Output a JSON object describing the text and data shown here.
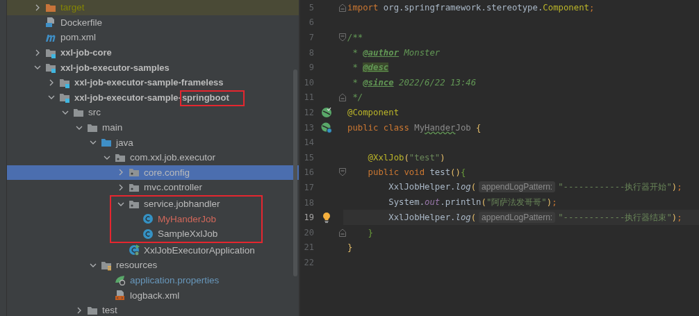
{
  "project_tree": {
    "items": [
      {
        "children": [
          {
            "label": "target",
            "kind": "excluded",
            "color": "#848504",
            "selected": false,
            "annotated": false,
            "expanded": false
          },
          {
            "label": "Dockerfile",
            "kind": "docker",
            "color": "#bbbbbb",
            "selected": false,
            "annotated": false
          },
          {
            "label": "pom.xml",
            "kind": "maven",
            "color": "#bbbbbb",
            "selected": false,
            "annotated": false
          }
        ]
      },
      {
        "label": "xxl-job-core",
        "kind": "module",
        "color": "#bbbbbb",
        "selected": false,
        "annotated": false,
        "expanded": false
      },
      {
        "label": "xxl-job-executor-samples",
        "kind": "module",
        "color": "#bbbbbb",
        "selected": false,
        "annotated": false,
        "expanded": true,
        "children": [
          {
            "label": "xxl-job-executor-sample-frameless",
            "kind": "module",
            "color": "#bbbbbb",
            "selected": false,
            "annotated": false,
            "expanded": false
          },
          {
            "label": "xxl-job-executor-sample-",
            "annotated_label": "springboot",
            "kind": "module",
            "color": "#bbbbbb",
            "selected": false,
            "annotated": false,
            "expanded": true,
            "children": [
              {
                "label": "src",
                "kind": "folder",
                "color": "#bbbbbb",
                "selected": false,
                "annotated": false,
                "expanded": true,
                "children": [
                  {
                    "label": "main",
                    "kind": "folder",
                    "color": "#bbbbbb",
                    "selected": false,
                    "annotated": false,
                    "expanded": true,
                    "children": [
                      {
                        "label": "java",
                        "kind": "source",
                        "color": "#bbbbbb",
                        "selected": false,
                        "annotated": false,
                        "expanded": true,
                        "children": [
                          {
                            "label": "com.xxl.job.executor",
                            "kind": "package",
                            "color": "#bbbbbb",
                            "selected": false,
                            "annotated": false,
                            "expanded": true,
                            "children": [
                              {
                                "label": "core.config",
                                "kind": "package",
                                "color": "#bbbbbb",
                                "selected": true,
                                "annotated": false,
                                "expanded": false
                              },
                              {
                                "label": "mvc.controller",
                                "kind": "package",
                                "color": "#bbbbbb",
                                "selected": false,
                                "annotated": false,
                                "expanded": false
                              },
                              {
                                "label": "service.jobhandler",
                                "kind": "package",
                                "color": "#bbbbbb",
                                "selected": false,
                                "annotated": true,
                                "expanded": true,
                                "children": [
                                  {
                                    "label": "MyHanderJob",
                                    "kind": "class",
                                    "color": "#d1675a",
                                    "selected": false,
                                    "annotated": false
                                  },
                                  {
                                    "label": "SampleXxlJob",
                                    "kind": "class",
                                    "color": "#bbbbbb",
                                    "selected": false,
                                    "annotated": false
                                  }
                                ]
                              },
                              {
                                "label": "XxlJobExecutorApplication",
                                "kind": "springclass",
                                "color": "#bbbbbb",
                                "selected": false,
                                "annotated": false
                              }
                            ]
                          }
                        ]
                      },
                      {
                        "label": "resources",
                        "kind": "resources",
                        "color": "#bbbbbb",
                        "selected": false,
                        "annotated": false,
                        "expanded": true,
                        "children": [
                          {
                            "label": "application.properties",
                            "kind": "properties",
                            "color": "#6897bb",
                            "selected": false,
                            "annotated": false
                          },
                          {
                            "label": "logback.xml",
                            "kind": "xml",
                            "color": "#bbbbbb",
                            "selected": false,
                            "annotated": false
                          }
                        ]
                      }
                    ]
                  },
                  {
                    "label": "test",
                    "kind": "folder",
                    "color": "#bbbbbb",
                    "selected": false,
                    "annotated": false,
                    "expanded": false
                  }
                ]
              }
            ]
          }
        ]
      }
    ]
  },
  "editor": {
    "lines": [
      {
        "number": "5",
        "kind": "plain",
        "current": false,
        "fold_start": false,
        "fold_end": true,
        "tokens": [
          {
            "text": "import",
            "kind": "keyword"
          },
          {
            "text": " org.springframework.stereotype.",
            "kind": "plain"
          },
          {
            "text": "Component",
            "kind": "annotation"
          },
          {
            "text": ";",
            "kind": "punct"
          }
        ]
      },
      {
        "number": "6",
        "kind": "plain",
        "current": false,
        "fold_start": false,
        "fold_end": false
      },
      {
        "number": "7",
        "kind": "plain",
        "current": false,
        "fold_start": true,
        "fold_end": false,
        "tokens": [
          {
            "text": "/**",
            "kind": "doc"
          }
        ]
      },
      {
        "number": "8",
        "kind": "plain",
        "current": false,
        "fold_start": false,
        "fold_end": false,
        "tokens": [
          {
            "text": " * ",
            "kind": "doc"
          },
          {
            "text": "@author",
            "kind": "doctag"
          },
          {
            "text": " Monster",
            "kind": "doc"
          }
        ]
      },
      {
        "number": "9",
        "kind": "plain",
        "current": false,
        "fold_start": false,
        "fold_end": false,
        "tokens": [
          {
            "text": " * ",
            "kind": "doc"
          },
          {
            "text": "@desc",
            "kind": "tagmark"
          }
        ]
      },
      {
        "number": "10",
        "kind": "plain",
        "current": false,
        "fold_start": false,
        "fold_end": false,
        "tokens": [
          {
            "text": " * ",
            "kind": "doc"
          },
          {
            "text": "@since",
            "kind": "doctag"
          },
          {
            "text": " 2022/6/22 13:46",
            "kind": "doc"
          }
        ]
      },
      {
        "number": "11",
        "kind": "plain",
        "current": false,
        "fold_start": false,
        "fold_end": true,
        "tokens": [
          {
            "text": " */",
            "kind": "doc"
          }
        ]
      },
      {
        "number": "12",
        "kind": "bean",
        "current": false,
        "fold_start": false,
        "fold_end": false,
        "tokens": [
          {
            "text": "@Component",
            "kind": "annotation"
          }
        ]
      },
      {
        "number": "13",
        "kind": "springbean",
        "current": false,
        "fold_start": false,
        "fold_end": false,
        "tokens": [
          {
            "text": "public class ",
            "kind": "keyword"
          },
          {
            "text": "My",
            "kind": "unused"
          },
          {
            "text": "Hander",
            "kind": "typo"
          },
          {
            "text": "Job ",
            "kind": "unused"
          },
          {
            "text": "{",
            "kind": "bracket"
          }
        ]
      },
      {
        "number": "14",
        "kind": "plain",
        "current": false,
        "fold_start": false,
        "fold_end": false
      },
      {
        "number": "15",
        "kind": "plain",
        "current": false,
        "fold_start": false,
        "fold_end": false,
        "tokens": [
          {
            "text": "    @XxlJob",
            "kind": "annotation"
          },
          {
            "text": "(",
            "kind": "bracket"
          },
          {
            "text": "\"test\"",
            "kind": "string"
          },
          {
            "text": ")",
            "kind": "bracket"
          }
        ]
      },
      {
        "number": "16",
        "kind": "plain",
        "current": false,
        "fold_start": true,
        "fold_end": false,
        "tokens": [
          {
            "text": "    public void ",
            "kind": "keyword"
          },
          {
            "text": "test",
            "kind": "plain"
          },
          {
            "text": "()",
            "kind": "bracket"
          },
          {
            "text": "{",
            "kind": "nested"
          }
        ]
      },
      {
        "number": "17",
        "kind": "plain",
        "current": false,
        "fold_start": false,
        "fold_end": false,
        "tokens": [
          {
            "text": "        XxlJobHelper.",
            "kind": "plain"
          },
          {
            "text": "log",
            "kind": "static"
          },
          {
            "text": "(",
            "kind": "bracket"
          },
          {
            "text": "appendLogPattern:",
            "kind": "hint"
          },
          {
            "text": "\"------------执行器开始\"",
            "kind": "string"
          },
          {
            "text": ")",
            "kind": "bracket"
          },
          {
            "text": ";",
            "kind": "punct"
          }
        ]
      },
      {
        "number": "18",
        "kind": "plain",
        "current": false,
        "fold_start": false,
        "fold_end": false,
        "tokens": [
          {
            "text": "        System.",
            "kind": "plain"
          },
          {
            "text": "out",
            "kind": "field"
          },
          {
            "text": ".println",
            "kind": "plain"
          },
          {
            "text": "(",
            "kind": "bracket"
          },
          {
            "text": "\"阿萨法发哥哥\"",
            "kind": "string"
          },
          {
            "text": ")",
            "kind": "bracket"
          },
          {
            "text": ";",
            "kind": "punct"
          }
        ]
      },
      {
        "number": "19",
        "kind": "bulb",
        "current": true,
        "fold_start": false,
        "fold_end": false,
        "tokens": [
          {
            "text": "        XxlJobHelper.",
            "kind": "plain"
          },
          {
            "text": "log",
            "kind": "static"
          },
          {
            "text": "(",
            "kind": "bracket"
          },
          {
            "text": "appendLogPattern:",
            "kind": "hint"
          },
          {
            "text": "\"------------执行器结束\"",
            "kind": "string"
          },
          {
            "text": ")",
            "kind": "bracket"
          },
          {
            "text": ";",
            "kind": "punct"
          }
        ]
      },
      {
        "number": "20",
        "kind": "plain",
        "current": false,
        "fold_start": false,
        "fold_end": true,
        "tokens": [
          {
            "text": "    }",
            "kind": "nested"
          }
        ]
      },
      {
        "number": "21",
        "kind": "plain",
        "current": false,
        "fold_start": false,
        "fold_end": false,
        "tokens": [
          {
            "text": "}",
            "kind": "bracket"
          }
        ]
      },
      {
        "number": "22",
        "kind": "plain",
        "current": false,
        "fold_start": false,
        "fold_end": false
      }
    ]
  }
}
